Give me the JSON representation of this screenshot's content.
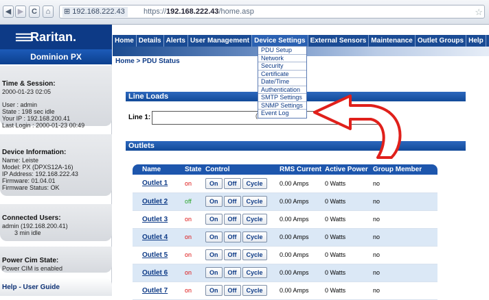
{
  "browser": {
    "back_icon": "back-arrow-icon",
    "forward_icon": "forward-arrow-icon",
    "reload_label": "C",
    "home_icon": "home-icon",
    "url_host": "192.168.222.43",
    "url_prefix": "https://",
    "url_domain": "192.168.222.43",
    "url_path": "/home.asp"
  },
  "brand": {
    "logo_text": "Raritan.",
    "product": "Dominion PX"
  },
  "nav": {
    "items": [
      "Home",
      "Details",
      "Alerts",
      "User Management",
      "Device Settings",
      "External Sensors",
      "Maintenance",
      "Outlet Groups",
      "Help"
    ],
    "active": "Device Settings"
  },
  "dropdown": {
    "items": [
      "PDU Setup",
      "Network",
      "Security",
      "Certificate",
      "Date/Time",
      "Authentication",
      "SMTP Settings",
      "SNMP Settings",
      "Event Log"
    ]
  },
  "breadcrumb": "Home > PDU Status",
  "sidebar": {
    "session_title": "Time & Session:",
    "session_date": "2000-01-23 02:05",
    "user": "User : admin",
    "state": "State : 198 sec idle",
    "ip": "Your IP : 192.168.200.41",
    "last_login": "Last Login : 2000-01-23 00:49",
    "device_title": "Device Information:",
    "device_name": "Name: Leiste",
    "device_model": "Model: PX (DPXS12A-16)",
    "device_ip": "IP Address: 192.168.222.43",
    "firmware": "Firmware: 01.04.01",
    "firmware_status": "Firmware Status: OK",
    "users_title": "Connected Users:",
    "users_line1": "admin (192.168.200.41)",
    "users_line2": "3 min idle",
    "power_title": "Power Cim State:",
    "power_line": "Power CIM is enabled",
    "help": "Help - User Guide"
  },
  "line_loads": {
    "title": "Line Loads",
    "label": "Line 1:",
    "marker": "("
  },
  "outlets": {
    "title": "Outlets",
    "columns": [
      "Name",
      "State",
      "Control",
      "RMS Current",
      "Active Power",
      "Group Member"
    ],
    "buttons": [
      "On",
      "Off",
      "Cycle"
    ],
    "rows": [
      {
        "name": "Outlet 1",
        "state": "on",
        "current": "0.00 Amps",
        "power": "0 Watts",
        "group": "no"
      },
      {
        "name": "Outlet 2",
        "state": "off",
        "current": "0.00 Amps",
        "power": "0 Watts",
        "group": "no"
      },
      {
        "name": "Outlet 3",
        "state": "on",
        "current": "0.00 Amps",
        "power": "0 Watts",
        "group": "no"
      },
      {
        "name": "Outlet 4",
        "state": "on",
        "current": "0.00 Amps",
        "power": "0 Watts",
        "group": "no"
      },
      {
        "name": "Outlet 5",
        "state": "on",
        "current": "0.00 Amps",
        "power": "0 Watts",
        "group": "no"
      },
      {
        "name": "Outlet 6",
        "state": "on",
        "current": "0.00 Amps",
        "power": "0 Watts",
        "group": "no"
      },
      {
        "name": "Outlet 7",
        "state": "on",
        "current": "0.00 Amps",
        "power": "0 Watts",
        "group": "no"
      }
    ]
  },
  "colors": {
    "brand_blue": "#0d3a86",
    "state_on": "#dd1111",
    "state_off": "#2aa52a",
    "arrow": "#e0201b"
  }
}
